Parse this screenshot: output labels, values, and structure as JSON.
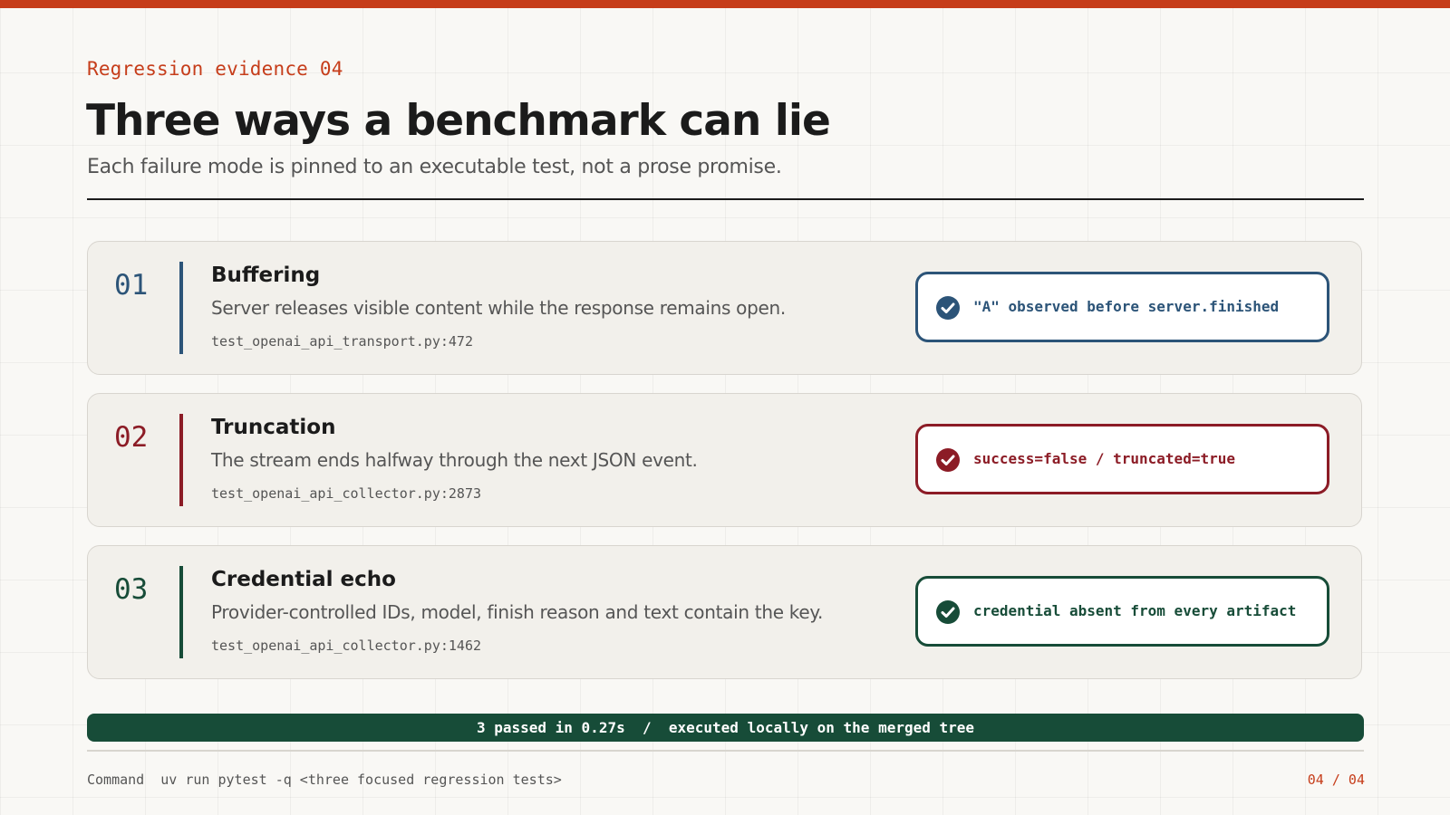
{
  "slide": {
    "eyebrow": "Regression evidence 04",
    "title": "Three ways a benchmark can lie",
    "subtitle": "Each failure mode is pinned to an executable test, not a prose promise.",
    "accent_color": "#c63d1a"
  },
  "cards": [
    {
      "number": "01",
      "name": "Buffering",
      "description": "Server releases visible content while the response remains open.",
      "test_ref": "test_openai_api_transport.py:472",
      "result": "\"A\" observed before server.finished",
      "result_icon": "check-circle-icon",
      "color": "#2c5478"
    },
    {
      "number": "02",
      "name": "Truncation",
      "description": "The stream ends halfway through the next JSON event.",
      "test_ref": "test_openai_api_collector.py:2873",
      "result": "success=false / truncated=true",
      "result_icon": "check-circle-icon",
      "color": "#8c1c26"
    },
    {
      "number": "03",
      "name": "Credential echo",
      "description": "Provider-controlled IDs, model, finish reason and text contain the key.",
      "test_ref": "test_openai_api_collector.py:1462",
      "result": "credential absent from every artifact",
      "result_icon": "check-circle-icon",
      "color": "#174c38"
    }
  ],
  "status": {
    "text": "3 passed in 0.27s  /  executed locally on the merged tree",
    "color": "#174c38"
  },
  "footer": {
    "command": "Command  uv run pytest -q <three focused regression tests>",
    "page": "04 / 04"
  }
}
